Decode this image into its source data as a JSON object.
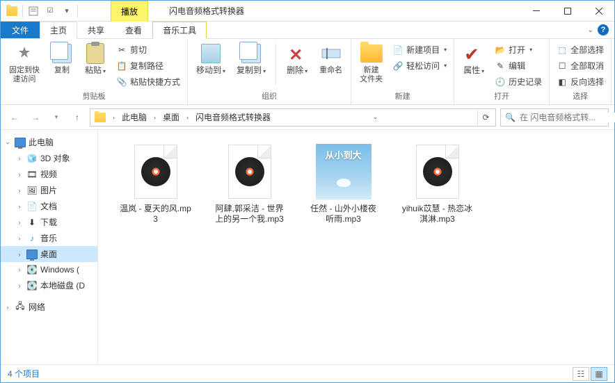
{
  "title": "闪电音频格式转换器",
  "titlebar_tab": "播放",
  "menu": {
    "file": "文件",
    "home": "主页",
    "share": "共享",
    "view": "查看",
    "music": "音乐工具"
  },
  "ribbon": {
    "pin": "固定到快\n速访问",
    "copy": "复制",
    "paste": "粘贴",
    "cut": "剪切",
    "copypath": "复制路径",
    "pasteshortcut": "粘贴快捷方式",
    "moveto": "移动到",
    "copyto": "复制到",
    "delete": "删除",
    "rename": "重命名",
    "newfolder": "新建\n文件夹",
    "newitem": "新建项目",
    "easyaccess": "轻松访问",
    "properties": "属性",
    "open": "打开",
    "edit": "编辑",
    "history": "历史记录",
    "selectall": "全部选择",
    "selectnone": "全部取消",
    "invert": "反向选择",
    "group_clipboard": "剪贴板",
    "group_organize": "组织",
    "group_new": "新建",
    "group_open": "打开",
    "group_select": "选择"
  },
  "breadcrumb": [
    "此电脑",
    "桌面",
    "闪电音频格式转换器"
  ],
  "search_placeholder": "在 闪电音频格式转...",
  "tree": {
    "thispc": "此电脑",
    "3d": "3D 对象",
    "videos": "视频",
    "pictures": "图片",
    "documents": "文档",
    "downloads": "下载",
    "music": "音乐",
    "desktop": "桌面",
    "windows": "Windows (",
    "localdisk": "本地磁盘 (D",
    "network": "网络"
  },
  "files": [
    {
      "name": "温岚 - 夏天的风.mp3",
      "type": "music"
    },
    {
      "name": "阿肆,郭采洁 - 世界上的另一个我.mp3",
      "type": "music"
    },
    {
      "name": "任然 - 山外小楼夜听雨.mp3",
      "type": "album",
      "album_text": "从小到大"
    },
    {
      "name": "yihuik苡慧 - 热恋冰淇淋.mp3",
      "type": "music"
    }
  ],
  "status": "4 个项目"
}
